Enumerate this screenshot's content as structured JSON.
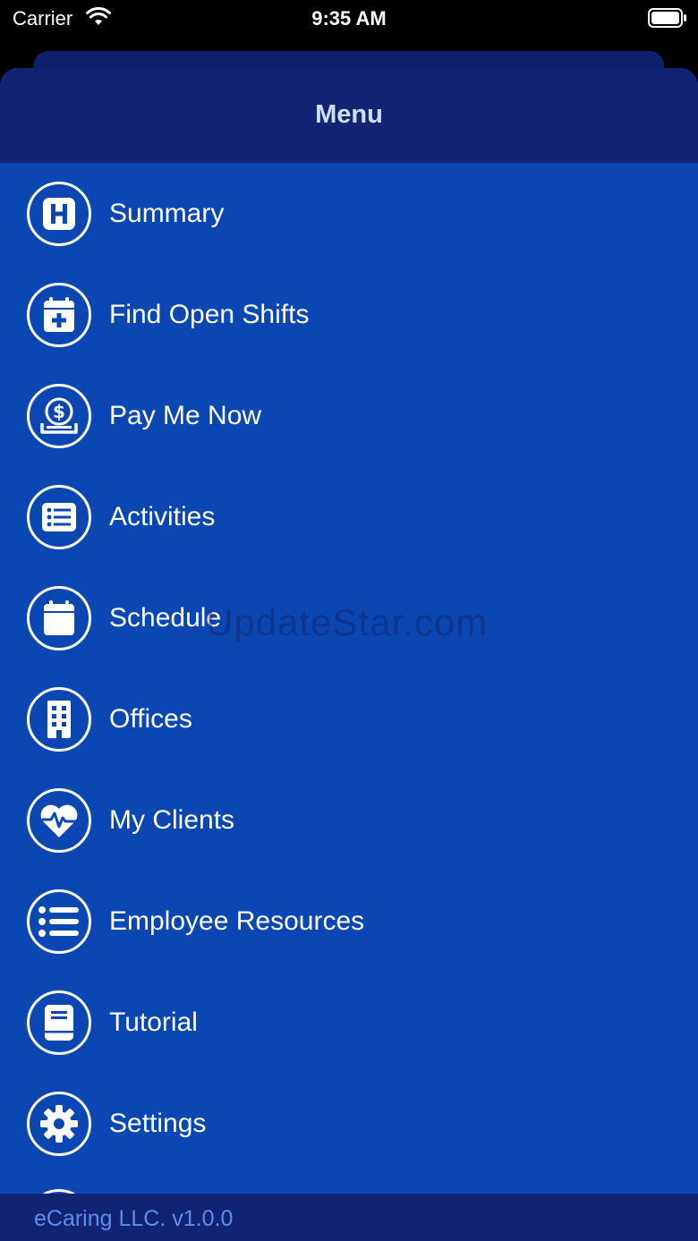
{
  "status_bar": {
    "carrier": "Carrier",
    "time": "9:35 AM"
  },
  "header": {
    "title": "Menu"
  },
  "menu": {
    "items": [
      {
        "label": "Summary",
        "icon": "hospital-icon"
      },
      {
        "label": "Find Open Shifts",
        "icon": "calendar-plus-icon"
      },
      {
        "label": "Pay Me Now",
        "icon": "money-hand-icon"
      },
      {
        "label": "Activities",
        "icon": "list-card-icon"
      },
      {
        "label": "Schedule",
        "icon": "calendar-icon"
      },
      {
        "label": "Offices",
        "icon": "building-icon"
      },
      {
        "label": "My Clients",
        "icon": "heart-pulse-icon"
      },
      {
        "label": "Employee Resources",
        "icon": "list-icon"
      },
      {
        "label": "Tutorial",
        "icon": "book-icon"
      },
      {
        "label": "Settings",
        "icon": "gear-icon"
      }
    ]
  },
  "watermark": "UpdateStar.com",
  "footer": {
    "version_text": "eCaring LLC. v1.0.0"
  },
  "colors": {
    "menu_background": "#0a47b3",
    "header_background": "#112474",
    "title_text": "#cfe0ff",
    "footer_text": "#5b8ee8"
  }
}
